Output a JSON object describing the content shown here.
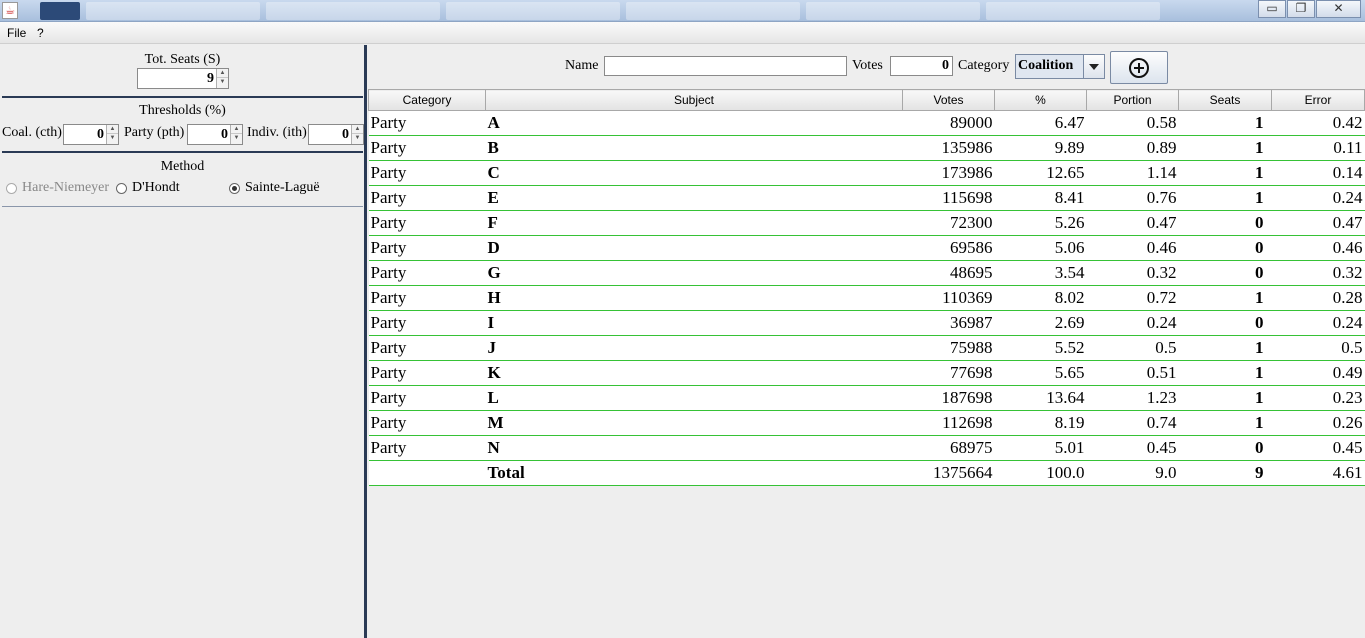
{
  "window": {
    "buttons": {
      "minimize": "▭",
      "restore": "❐",
      "close": "✕"
    }
  },
  "menu": {
    "file": "File",
    "help": "?"
  },
  "left": {
    "seats": {
      "title": "Tot. Seats (S)",
      "value": "9"
    },
    "thresholds": {
      "title": "Thresholds (%)",
      "coal_label": "Coal. (cth)",
      "coal_value": "0",
      "party_label": "Party (pth)",
      "party_value": "0",
      "indiv_label": "Indiv. (ith)",
      "indiv_value": "0"
    },
    "method": {
      "title": "Method",
      "options": [
        "Hare-Niemeyer",
        "D'Hondt",
        "Sainte-Laguë"
      ],
      "selected": "Sainte-Laguë"
    }
  },
  "toolbar": {
    "name_label": "Name",
    "name_value": "",
    "votes_label": "Votes",
    "votes_value": "0",
    "category_label": "Category",
    "category_value": "Coalition"
  },
  "table": {
    "columns": [
      "Category",
      "Subject",
      "Votes",
      "%",
      "Portion",
      "Seats",
      "Error"
    ],
    "rows": [
      [
        "Party",
        "A",
        "89000",
        "6.47",
        "0.58",
        "1",
        "0.42"
      ],
      [
        "Party",
        "B",
        "135986",
        "9.89",
        "0.89",
        "1",
        "0.11"
      ],
      [
        "Party",
        "C",
        "173986",
        "12.65",
        "1.14",
        "1",
        "0.14"
      ],
      [
        "Party",
        "E",
        "115698",
        "8.41",
        "0.76",
        "1",
        "0.24"
      ],
      [
        "Party",
        "F",
        "72300",
        "5.26",
        "0.47",
        "0",
        "0.47"
      ],
      [
        "Party",
        "D",
        "69586",
        "5.06",
        "0.46",
        "0",
        "0.46"
      ],
      [
        "Party",
        "G",
        "48695",
        "3.54",
        "0.32",
        "0",
        "0.32"
      ],
      [
        "Party",
        "H",
        "110369",
        "8.02",
        "0.72",
        "1",
        "0.28"
      ],
      [
        "Party",
        "I",
        "36987",
        "2.69",
        "0.24",
        "0",
        "0.24"
      ],
      [
        "Party",
        "J",
        "75988",
        "5.52",
        "0.5",
        "1",
        "0.5"
      ],
      [
        "Party",
        "K",
        "77698",
        "5.65",
        "0.51",
        "1",
        "0.49"
      ],
      [
        "Party",
        "L",
        "187698",
        "13.64",
        "1.23",
        "1",
        "0.23"
      ],
      [
        "Party",
        "M",
        "112698",
        "8.19",
        "0.74",
        "1",
        "0.26"
      ],
      [
        "Party",
        "N",
        "68975",
        "5.01",
        "0.45",
        "0",
        "0.45"
      ]
    ],
    "total": [
      "",
      "Total",
      "1375664",
      "100.0",
      "9.0",
      "9",
      "4.61"
    ]
  }
}
